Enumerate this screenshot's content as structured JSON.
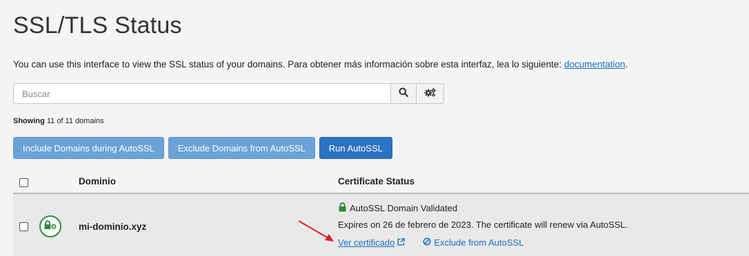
{
  "page": {
    "title": "SSL/TLS Status",
    "intro_text": "You can use this interface to view the SSL status of your domains. Para obtener más información sobre esta interfaz, lea lo siguiente: ",
    "intro_link": "documentation",
    "intro_end": "."
  },
  "search": {
    "placeholder": "Buscar",
    "value": "",
    "search_icon": "search-icon",
    "settings_icon": "gears-icon"
  },
  "showing": {
    "label": "Showing",
    "text": " 11 of 11 domains"
  },
  "actions": {
    "include_label": "Include Domains during AutoSSL",
    "exclude_label": "Exclude Domains from AutoSSL",
    "run_label": "Run AutoSSL"
  },
  "table": {
    "headers": {
      "domain": "Dominio",
      "certificate_status": "Certificate Status"
    },
    "rows": [
      {
        "domain": "mi-dominio.xyz",
        "status_icon": "lock-icon",
        "status": "AutoSSL Domain Validated",
        "expires": "Expires on 26 de febrero de 2023. The certificate will renew via AutoSSL.",
        "view_cert_label": "Ver certificado",
        "exclude_label": "Exclude from AutoSSL"
      }
    ]
  },
  "colors": {
    "link": "#1a6fc2",
    "primary_button": "#2e72c2",
    "light_button": "#6aa3d8",
    "valid_green": "#2f8a3a",
    "annotation_arrow": "#e02020"
  }
}
